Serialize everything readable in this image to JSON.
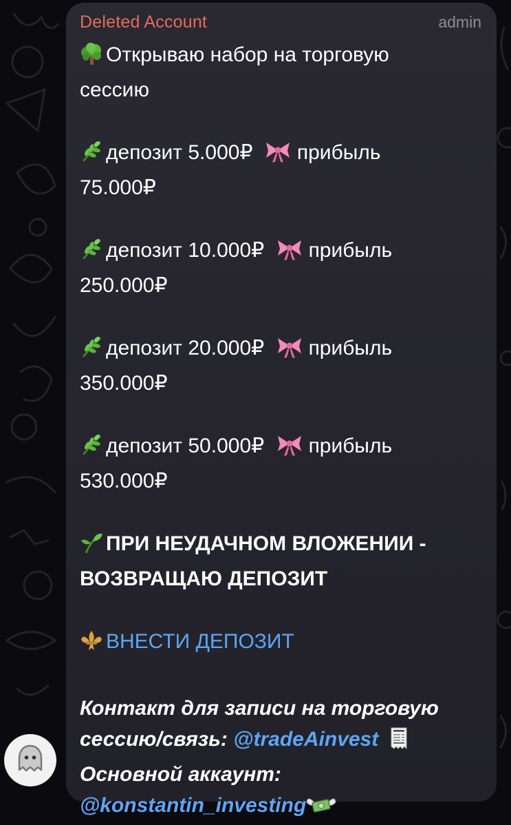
{
  "message": {
    "sender": "Deleted Account",
    "role": "admin",
    "intro": [
      "Открываю набор на торговую",
      "сессию"
    ],
    "tiers": [
      {
        "line1": "депозит 5.000₽",
        "profit_word": "прибыль",
        "line2": "75.000₽"
      },
      {
        "line1": "депозит 10.000₽",
        "profit_word": "прибыль",
        "line2": "250.000₽"
      },
      {
        "line1": "депозит 20.000₽",
        "profit_word": "прибыль",
        "line2": "350.000₽"
      },
      {
        "line1": "депозит 50.000₽",
        "profit_word": "прибыль",
        "line2": "530.000₽"
      }
    ],
    "guarantee": [
      "ПРИ НЕУДАЧНОМ ВЛОЖЕНИИ -",
      "ВОЗВРАЩАЮ ДЕПОЗИТ"
    ],
    "deposit_link": "ВНЕСТИ ДЕПОЗИТ",
    "contact": {
      "line1": "Контакт для записи на торговую",
      "line2_prefix": "сессию/связь:",
      "handle1": "@tradeAinvest",
      "line3": "Основной аккаунт:",
      "handle2": "@konstantin_investing"
    }
  },
  "icons": {
    "avatar": "ghost-icon",
    "intro": "tree-emoji",
    "tier_leaf": "herb-emoji",
    "tier_bow": "ribbon-emoji",
    "guarantee": "seedling-emoji",
    "deposit": "fleur-de-lis-emoji",
    "handle1_after": "receipt-emoji",
    "handle2_after": "money-wings-emoji"
  },
  "colors": {
    "sender": "#e26b5c",
    "link": "#5ca6f5",
    "bubble": "#28272f",
    "background": "#0b0a0f"
  }
}
